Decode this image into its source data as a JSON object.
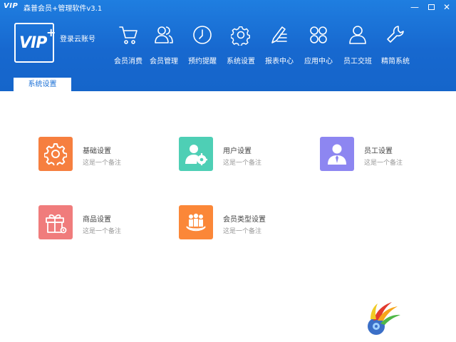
{
  "window": {
    "logo_text": "VIP",
    "title": "森普会员+管理软件v3.1",
    "minimize": "—",
    "close": "✕"
  },
  "header": {
    "logo_text": "VIP",
    "logo_plus": "+",
    "login_label": "登录云账号"
  },
  "nav": [
    {
      "label": "会员消费",
      "icon": "cart-icon"
    },
    {
      "label": "会员管理",
      "icon": "users-icon"
    },
    {
      "label": "预约提醒",
      "icon": "clock-icon"
    },
    {
      "label": "系统设置",
      "icon": "gear-icon"
    },
    {
      "label": "报表中心",
      "icon": "pen-list-icon"
    },
    {
      "label": "应用中心",
      "icon": "grid-circles-icon"
    },
    {
      "label": "员工交班",
      "icon": "person-icon"
    },
    {
      "label": "精简系统",
      "icon": "wrench-icon"
    }
  ],
  "tabs": [
    {
      "label": "系统设置",
      "active": true
    }
  ],
  "cards": [
    {
      "title": "基础设置",
      "note": "这是一个备注",
      "icon": "gear-icon",
      "color": "#f67f3f"
    },
    {
      "title": "用户设置",
      "note": "这是一个备注",
      "icon": "user-gear-icon",
      "color": "#4ecfb5"
    },
    {
      "title": "员工设置",
      "note": "这是一个备注",
      "icon": "employee-icon",
      "color": "#8d86f1"
    },
    {
      "title": "商品设置",
      "note": "这是一个备注",
      "icon": "gift-gear-icon",
      "color": "#f07c7c"
    },
    {
      "title": "会员类型设置",
      "note": "这是一个备注",
      "icon": "group-icon",
      "color": "#fb8738"
    }
  ],
  "colors": {
    "header_blue": "#1768cf",
    "tab_text": "#1a6fd6"
  }
}
